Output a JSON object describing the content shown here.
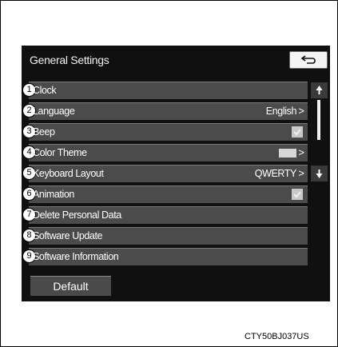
{
  "header": {
    "title": "General Settings",
    "back_icon": "back-arrow-icon"
  },
  "menu": {
    "items": [
      {
        "num": "1",
        "label": "Clock",
        "value": "",
        "control": "none"
      },
      {
        "num": "2",
        "label": "Language",
        "value": "English",
        "control": "chevron"
      },
      {
        "num": "3",
        "label": "Beep",
        "value": "",
        "control": "checkbox",
        "checked": true
      },
      {
        "num": "4",
        "label": "Color Theme",
        "value": "",
        "control": "swatch"
      },
      {
        "num": "5",
        "label": "Keyboard Layout",
        "value": "QWERTY",
        "control": "chevron"
      },
      {
        "num": "6",
        "label": "Animation",
        "value": "",
        "control": "checkbox",
        "checked": true
      },
      {
        "num": "7",
        "label": "Delete Personal Data",
        "value": "",
        "control": "none"
      },
      {
        "num": "8",
        "label": "Software Update",
        "value": "",
        "control": "none"
      },
      {
        "num": "9",
        "label": "Software Information",
        "value": "",
        "control": "none"
      }
    ],
    "chevron": ">"
  },
  "footer": {
    "default_label": "Default"
  },
  "caption": "CTY50BJ037US",
  "colors": {
    "screen_bg": "#101010",
    "row_bg": "#4b4b4b",
    "text": "#ffffff"
  }
}
